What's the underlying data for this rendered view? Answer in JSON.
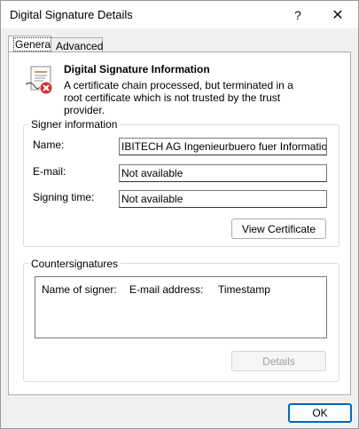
{
  "window": {
    "title": "Digital Signature Details",
    "help_glyph": "?",
    "close_glyph": "✕"
  },
  "tabs": [
    {
      "label": "General",
      "selected": true
    },
    {
      "label": "Advanced",
      "selected": false
    }
  ],
  "info": {
    "title": "Digital Signature Information",
    "message": "A certificate chain processed, but terminated in a root certificate which is not trusted by the trust provider.",
    "icon": "certificate-error-icon"
  },
  "signer": {
    "group_label": "Signer information",
    "name_label": "Name:",
    "name_value": "IBITECH AG Ingenieurbuero fuer Informationste",
    "email_label": "E-mail:",
    "email_value": "Not available",
    "time_label": "Signing time:",
    "time_value": "Not available",
    "view_cert_label": "View Certificate"
  },
  "countersignatures": {
    "group_label": "Countersignatures",
    "columns": [
      "Name of signer:",
      "E-mail address:",
      "Timestamp"
    ],
    "rows": [],
    "details_label": "Details"
  },
  "footer": {
    "ok_label": "OK"
  },
  "colors": {
    "accent": "#0067c0",
    "error": "#d32f2f"
  }
}
